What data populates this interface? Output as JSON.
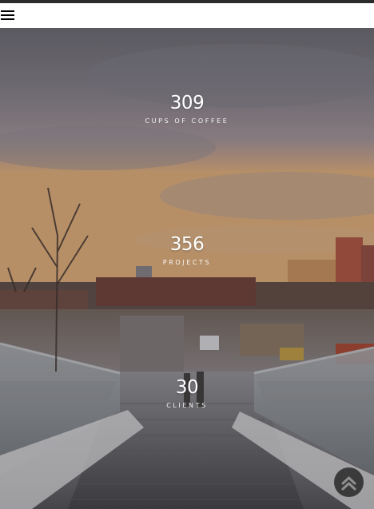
{
  "navbar": {
    "menu_icon": "hamburger-menu-icon"
  },
  "stats": [
    {
      "value": "309",
      "label": "CUPS OF COFFEE"
    },
    {
      "value": "356",
      "label": "PROJECTS"
    },
    {
      "value": "30",
      "label": "CLIENTS"
    }
  ],
  "scroll_top": {
    "icon": "chevron-up-double-icon"
  },
  "colors": {
    "navbar_bg": "#ffffff",
    "text": "#ffffff",
    "button_bg": "#1e1e1e"
  }
}
